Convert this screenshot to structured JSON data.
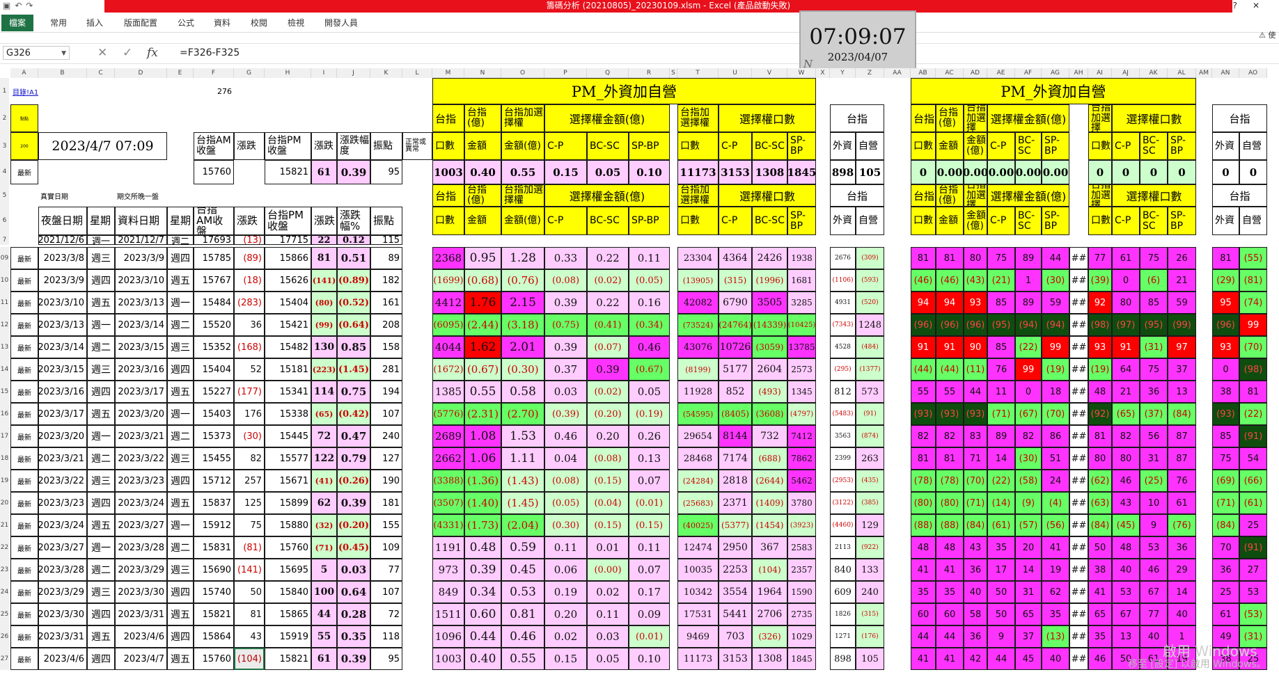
{
  "window": {
    "title": "籌碼分析 (20210805)_20230109.xlsm - Excel (產品啟動失敗)",
    "qat_icons": [
      "save-icon",
      "undo-icon",
      "redo-icon"
    ]
  },
  "ribbon": {
    "file": "檔案",
    "tabs": [
      "常用",
      "插入",
      "版面配置",
      "公式",
      "資料",
      "校閱",
      "檢視",
      "開發人員"
    ],
    "warning_text": "⚠ 使"
  },
  "formula_bar": {
    "name_box": "G326",
    "formula": "=F326-F325",
    "cancel_icon": "✕",
    "enter_icon": "✓",
    "fx_icon": "fx"
  },
  "clock": {
    "time": "07:09:07",
    "date": "2023/04/07",
    "mark": "N"
  },
  "col_letters": [
    "A",
    "B",
    "C",
    "D",
    "E",
    "F",
    "G",
    "H",
    "I",
    "J",
    "K",
    "L",
    "M",
    "N",
    "O",
    "P",
    "Q",
    "R",
    "S",
    "T",
    "U",
    "V",
    "W",
    "X",
    "Y",
    "Z",
    "AA",
    "AB",
    "AC",
    "AD",
    "AE",
    "AF",
    "AG",
    "AH",
    "AI",
    "AJ",
    "AK",
    "AL",
    "AM",
    "AN",
    "AO"
  ],
  "row_numbers": [
    "1",
    "2",
    "3",
    "4",
    "5",
    "6",
    "7",
    "309",
    "310",
    "311",
    "312",
    "313",
    "314",
    "315",
    "316",
    "317",
    "318",
    "319",
    "320",
    "321",
    "322",
    "323",
    "324",
    "325",
    "326",
    "327"
  ],
  "top": {
    "link": "目錄!A1",
    "r1_F": "276",
    "r2_A": "點點",
    "r3_A": "200",
    "datetime": "2023/4/7 07:09",
    "r4_A": "最新",
    "r4_F": "15760",
    "r4_H": "15821",
    "r4_I": "61",
    "r4_J": "0.39",
    "r4_K": "95",
    "r5_B": "真實日期",
    "r5_D": "期交所晚一盤",
    "r7": [
      "2021/12/6",
      "週一",
      "2021/12/7",
      "週二",
      "17693",
      "(13)",
      "17715",
      "22",
      "0.12",
      "115"
    ]
  },
  "headers": {
    "F3": "台指AM收盤",
    "G3": "漲跌",
    "H3": "台指PM收盤",
    "I3": "漲跌",
    "J3": "漲跌幅度",
    "K3": "振點",
    "L3": "正常或異常",
    "B6": "夜盤日期",
    "C6": "星期",
    "D6": "資料日期",
    "E6": "星期",
    "F6": "台指AM收盤",
    "G6": "漲跌",
    "H6": "台指PM收盤",
    "I6": "漲跌",
    "J6": "漲跌幅%",
    "K6": "振點"
  },
  "pm_block": {
    "title": "PM_外資加自營",
    "row2": [
      "台指",
      "台指(億)",
      "台指加選擇權",
      "選擇權金額(億)",
      "台指加選擇權",
      "選擇權口數",
      "台指"
    ],
    "row3": [
      "口數",
      "金額",
      "金額(億)",
      "C-P",
      "BC-SC",
      "SP-BP",
      "口數",
      "C-P",
      "BC-SC",
      "SP-BP",
      "外資",
      "自營"
    ],
    "row4": [
      "1003",
      "0.40",
      "0.55",
      "0.15",
      "0.05",
      "0.10",
      "11173",
      "3153",
      "1308",
      "1845",
      "898",
      "105"
    ]
  },
  "am_block": {
    "title": "PM_外資加自營",
    "row2": [
      "台指",
      "台指(億)",
      "台指加選擇",
      "選擇權金額(億)",
      "台指加選擇",
      "選擇權口數",
      "台指"
    ],
    "row3": [
      "口數",
      "金額",
      "金額(億)",
      "C-P",
      "BC-SC",
      "SP-BP",
      "口數",
      "C-P",
      "BC-SC",
      "SP-BP",
      "外資",
      "自營"
    ],
    "row4": [
      "0",
      "0.00",
      "0.00",
      "0.00",
      "0.00",
      "0.00",
      "0",
      "0",
      "0",
      "0",
      "0",
      "0"
    ]
  },
  "rows": [
    {
      "a": "最新",
      "b": "2023/3/8",
      "c": "週三",
      "d": "2023/3/9",
      "e": "週四",
      "f": "15785",
      "g": "(89)",
      "h": "15866",
      "i": "81",
      "j": "0.51",
      "k": "89",
      "m": "2368",
      "n": "0.95",
      "o": "1.28",
      "p": "0.33",
      "q": "0.22",
      "r": "0.11",
      "t": "23304",
      "u": "4364",
      "v": "2426",
      "w": "1938",
      "y": "2676",
      "z": "(309)",
      "right": [
        "81",
        "81",
        "80",
        "75",
        "89",
        "44",
        "##",
        "77",
        "61",
        "75",
        "26"
      ],
      "an": "81",
      "ao": "(55)"
    },
    {
      "a": "最新",
      "b": "2023/3/9",
      "c": "週四",
      "d": "2023/3/10",
      "e": "週五",
      "f": "15767",
      "g": "(18)",
      "h": "15626",
      "i": "(141)",
      "j": "(0.89)",
      "k": "182",
      "m": "(1699)",
      "n": "(0.68)",
      "o": "(0.76)",
      "p": "(0.08)",
      "q": "(0.02)",
      "r": "(0.05)",
      "t": "(13905)",
      "u": "(315)",
      "v": "(1996)",
      "w": "1681",
      "y": "(1106)",
      "z": "(593)",
      "right": [
        "(46)",
        "(46)",
        "(43)",
        "(21)",
        "1",
        "(30)",
        "##",
        "(39)",
        "0",
        "(6)",
        "21"
      ],
      "an": "(29)",
      "ao": "(81)"
    },
    {
      "a": "最新",
      "b": "2023/3/10",
      "c": "週五",
      "d": "2023/3/13",
      "e": "週一",
      "f": "15484",
      "g": "(283)",
      "h": "15404",
      "i": "(80)",
      "j": "(0.52)",
      "k": "161",
      "m": "4412",
      "n": "1.76",
      "o": "2.15",
      "p": "0.39",
      "q": "0.22",
      "r": "0.16",
      "t": "42082",
      "u": "6790",
      "v": "3505",
      "w": "3285",
      "y": "4931",
      "z": "(520)",
      "right": [
        "94",
        "94",
        "93",
        "85",
        "89",
        "59",
        "##",
        "92",
        "80",
        "85",
        "59"
      ],
      "an": "95",
      "ao": "(74)"
    },
    {
      "a": "最新",
      "b": "2023/3/13",
      "c": "週一",
      "d": "2023/3/14",
      "e": "週二",
      "f": "15520",
      "g": "36",
      "h": "15421",
      "i": "(99)",
      "j": "(0.64)",
      "k": "208",
      "m": "(6095)",
      "n": "(2.44)",
      "o": "(3.18)",
      "p": "(0.75)",
      "q": "(0.41)",
      "r": "(0.34)",
      "t": "(73524)",
      "u": "(24764)",
      "v": "(14339)",
      "w": "(10425)",
      "y": "(7343)",
      "z": "1248",
      "right": [
        "(96)",
        "(96)",
        "(96)",
        "(95)",
        "(94)",
        "(94)",
        "##",
        "(98)",
        "(97)",
        "(95)",
        "(99)"
      ],
      "an": "(96)",
      "ao": "99"
    },
    {
      "a": "最新",
      "b": "2023/3/14",
      "c": "週二",
      "d": "2023/3/15",
      "e": "週三",
      "f": "15352",
      "g": "(168)",
      "h": "15482",
      "i": "130",
      "j": "0.85",
      "k": "158",
      "m": "4044",
      "n": "1.62",
      "o": "2.01",
      "p": "0.39",
      "q": "(0.07)",
      "r": "0.46",
      "t": "43076",
      "u": "10726",
      "v": "(3059)",
      "w": "13785",
      "y": "4528",
      "z": "(484)",
      "right": [
        "91",
        "91",
        "90",
        "85",
        "(22)",
        "99",
        "##",
        "93",
        "91",
        "(31)",
        "97"
      ],
      "an": "93",
      "ao": "(70)"
    },
    {
      "a": "最新",
      "b": "2023/3/15",
      "c": "週三",
      "d": "2023/3/16",
      "e": "週四",
      "f": "15404",
      "g": "52",
      "h": "15181",
      "i": "(223)",
      "j": "(1.45)",
      "k": "281",
      "m": "(1672)",
      "n": "(0.67)",
      "o": "(0.30)",
      "p": "0.37",
      "q": "0.39",
      "r": "(0.67)",
      "t": "(8199)",
      "u": "5177",
      "v": "2604",
      "w": "2573",
      "y": "(295)",
      "z": "(1377)",
      "right": [
        "(44)",
        "(44)",
        "(11)",
        "76",
        "99",
        "(19)",
        "##",
        "(19)",
        "64",
        "75",
        "37"
      ],
      "an": "0",
      "ao": "(98)"
    },
    {
      "a": "最新",
      "b": "2023/3/16",
      "c": "週四",
      "d": "2023/3/17",
      "e": "週五",
      "f": "15227",
      "g": "(177)",
      "h": "15341",
      "i": "114",
      "j": "0.75",
      "k": "194",
      "m": "1385",
      "n": "0.55",
      "o": "0.58",
      "p": "0.03",
      "q": "(0.02)",
      "r": "0.05",
      "t": "11928",
      "u": "852",
      "v": "(493)",
      "w": "1345",
      "y": "812",
      "z": "573",
      "right": [
        "55",
        "55",
        "44",
        "11",
        "0",
        "18",
        "##",
        "48",
        "21",
        "36",
        "13"
      ],
      "an": "38",
      "ao": "81"
    },
    {
      "a": "最新",
      "b": "2023/3/17",
      "c": "週五",
      "d": "2023/3/20",
      "e": "週一",
      "f": "15403",
      "g": "176",
      "h": "15338",
      "i": "(65)",
      "j": "(0.42)",
      "k": "107",
      "m": "(5776)",
      "n": "(2.31)",
      "o": "(2.70)",
      "p": "(0.39)",
      "q": "(0.20)",
      "r": "(0.19)",
      "t": "(54595)",
      "u": "(8405)",
      "v": "(3608)",
      "w": "(4797)",
      "y": "(5483)",
      "z": "(91)",
      "right": [
        "(93)",
        "(93)",
        "(93)",
        "(71)",
        "(67)",
        "(70)",
        "##",
        "(92)",
        "(65)",
        "(37)",
        "(84)"
      ],
      "an": "(93)",
      "ao": "(22)"
    },
    {
      "a": "最新",
      "b": "2023/3/20",
      "c": "週一",
      "d": "2023/3/21",
      "e": "週二",
      "f": "15373",
      "g": "(30)",
      "h": "15445",
      "i": "72",
      "j": "0.47",
      "k": "240",
      "m": "2689",
      "n": "1.08",
      "o": "1.53",
      "p": "0.46",
      "q": "0.20",
      "r": "0.26",
      "t": "29654",
      "u": "8144",
      "v": "732",
      "w": "7412",
      "y": "3563",
      "z": "(874)",
      "right": [
        "82",
        "82",
        "83",
        "89",
        "82",
        "86",
        "##",
        "81",
        "82",
        "56",
        "87"
      ],
      "an": "85",
      "ao": "(91)"
    },
    {
      "a": "最新",
      "b": "2023/3/21",
      "c": "週二",
      "d": "2023/3/22",
      "e": "週三",
      "f": "15455",
      "g": "82",
      "h": "15577",
      "i": "122",
      "j": "0.79",
      "k": "127",
      "m": "2662",
      "n": "1.06",
      "o": "1.11",
      "p": "0.04",
      "q": "(0.08)",
      "r": "0.13",
      "t": "28468",
      "u": "7174",
      "v": "(688)",
      "w": "7862",
      "y": "2399",
      "z": "263",
      "right": [
        "81",
        "81",
        "71",
        "14",
        "(30)",
        "51",
        "##",
        "80",
        "80",
        "31",
        "87"
      ],
      "an": "75",
      "ao": "54"
    },
    {
      "a": "最新",
      "b": "2023/3/22",
      "c": "週三",
      "d": "2023/3/23",
      "e": "週四",
      "f": "15712",
      "g": "257",
      "h": "15671",
      "i": "(41)",
      "j": "(0.26)",
      "k": "190",
      "m": "(3388)",
      "n": "(1.36)",
      "o": "(1.43)",
      "p": "(0.08)",
      "q": "(0.15)",
      "r": "0.07",
      "t": "(24284)",
      "u": "2818",
      "v": "(2644)",
      "w": "5462",
      "y": "(2953)",
      "z": "(435)",
      "right": [
        "(78)",
        "(78)",
        "(70)",
        "(22)",
        "(58)",
        "24",
        "##",
        "(62)",
        "46",
        "(25)",
        "76"
      ],
      "an": "(69)",
      "ao": "(66)"
    },
    {
      "a": "最新",
      "b": "2023/3/23",
      "c": "週四",
      "d": "2023/3/24",
      "e": "週五",
      "f": "15837",
      "g": "125",
      "h": "15899",
      "i": "62",
      "j": "0.39",
      "k": "181",
      "m": "(3507)",
      "n": "(1.40)",
      "o": "(1.45)",
      "p": "(0.05)",
      "q": "(0.04)",
      "r": "(0.01)",
      "t": "(25683)",
      "u": "2371",
      "v": "(1409)",
      "w": "3780",
      "y": "(3122)",
      "z": "(385)",
      "right": [
        "(80)",
        "(80)",
        "(71)",
        "(14)",
        "(9)",
        "(4)",
        "##",
        "(63)",
        "43",
        "10",
        "61"
      ],
      "an": "(71)",
      "ao": "(61)"
    },
    {
      "a": "最新",
      "b": "2023/3/24",
      "c": "週五",
      "d": "2023/3/27",
      "e": "週一",
      "f": "15912",
      "g": "75",
      "h": "15880",
      "i": "(32)",
      "j": "(0.20)",
      "k": "155",
      "m": "(4331)",
      "n": "(1.73)",
      "o": "(2.04)",
      "p": "(0.30)",
      "q": "(0.15)",
      "r": "(0.15)",
      "t": "(40025)",
      "u": "(5377)",
      "v": "(1454)",
      "w": "(3923)",
      "y": "(4460)",
      "z": "129",
      "right": [
        "(88)",
        "(88)",
        "(84)",
        "(61)",
        "(57)",
        "(56)",
        "##",
        "(84)",
        "(45)",
        "9",
        "(76)"
      ],
      "an": "(84)",
      "ao": "25"
    },
    {
      "a": "最新",
      "b": "2023/3/27",
      "c": "週一",
      "d": "2023/3/28",
      "e": "週二",
      "f": "15831",
      "g": "(81)",
      "h": "15760",
      "i": "(71)",
      "j": "(0.45)",
      "k": "109",
      "m": "1191",
      "n": "0.48",
      "o": "0.59",
      "p": "0.11",
      "q": "0.01",
      "r": "0.11",
      "t": "12474",
      "u": "2950",
      "v": "367",
      "w": "2583",
      "y": "2113",
      "z": "(922)",
      "right": [
        "48",
        "48",
        "43",
        "35",
        "20",
        "41",
        "##",
        "50",
        "48",
        "53",
        "36"
      ],
      "an": "70",
      "ao": "(91)"
    },
    {
      "a": "最新",
      "b": "2023/3/28",
      "c": "週二",
      "d": "2023/3/29",
      "e": "週三",
      "f": "15690",
      "g": "(141)",
      "h": "15695",
      "i": "5",
      "j": "0.03",
      "k": "77",
      "m": "973",
      "n": "0.39",
      "o": "0.45",
      "p": "0.06",
      "q": "(0.00)",
      "r": "0.07",
      "t": "10035",
      "u": "2253",
      "v": "(104)",
      "w": "2357",
      "y": "840",
      "z": "133",
      "right": [
        "41",
        "41",
        "36",
        "17",
        "14",
        "19",
        "##",
        "38",
        "40",
        "46",
        "29"
      ],
      "an": "36",
      "ao": "27"
    },
    {
      "a": "最新",
      "b": "2023/3/29",
      "c": "週三",
      "d": "2023/3/30",
      "e": "週四",
      "f": "15740",
      "g": "50",
      "h": "15840",
      "i": "100",
      "j": "0.64",
      "k": "107",
      "m": "849",
      "n": "0.34",
      "o": "0.53",
      "p": "0.19",
      "q": "0.02",
      "r": "0.17",
      "t": "10342",
      "u": "3554",
      "v": "1964",
      "w": "1590",
      "y": "609",
      "z": "240",
      "right": [
        "35",
        "35",
        "40",
        "50",
        "31",
        "62",
        "##",
        "41",
        "53",
        "67",
        "14"
      ],
      "an": "25",
      "ao": "53"
    },
    {
      "a": "最新",
      "b": "2023/3/30",
      "c": "週四",
      "d": "2023/3/31",
      "e": "週五",
      "f": "15821",
      "g": "81",
      "h": "15865",
      "i": "44",
      "j": "0.28",
      "k": "72",
      "m": "1511",
      "n": "0.60",
      "o": "0.81",
      "p": "0.20",
      "q": "0.11",
      "r": "0.09",
      "t": "17531",
      "u": "5441",
      "v": "2706",
      "w": "2735",
      "y": "1826",
      "z": "(315)",
      "right": [
        "60",
        "60",
        "58",
        "50",
        "65",
        "35",
        "##",
        "65",
        "67",
        "77",
        "40"
      ],
      "an": "61",
      "ao": "(53)"
    },
    {
      "a": "最新",
      "b": "2023/3/31",
      "c": "週五",
      "d": "2023/4/6",
      "e": "週四",
      "f": "15864",
      "g": "43",
      "h": "15919",
      "i": "55",
      "j": "0.35",
      "k": "118",
      "m": "1096",
      "n": "0.44",
      "o": "0.46",
      "p": "0.02",
      "q": "0.03",
      "r": "(0.01)",
      "t": "9469",
      "u": "703",
      "v": "(326)",
      "w": "1029",
      "y": "1271",
      "z": "(176)",
      "right": [
        "44",
        "44",
        "36",
        "9",
        "37",
        "(13)",
        "##",
        "35",
        "13",
        "40",
        "1"
      ],
      "an": "49",
      "ao": "(31)"
    },
    {
      "a": "最新",
      "b": "2023/4/6",
      "c": "週四",
      "d": "2023/4/7",
      "e": "週五",
      "f": "15760",
      "g": "(104)",
      "h": "15821",
      "i": "61",
      "j": "0.39",
      "k": "95",
      "m": "1003",
      "n": "0.40",
      "o": "0.55",
      "p": "0.15",
      "q": "0.05",
      "r": "0.10",
      "t": "11173",
      "u": "3153",
      "v": "1308",
      "w": "1845",
      "y": "898",
      "z": "105",
      "right": [
        "41",
        "41",
        "42",
        "44",
        "45",
        "40",
        "##",
        "46",
        "50",
        "61",
        "19"
      ],
      "an": "38",
      "ao": "25"
    }
  ],
  "watermark": {
    "line1": "啟用 Windows",
    "line2": "移至 [設定] 以啟用 Windows。"
  }
}
